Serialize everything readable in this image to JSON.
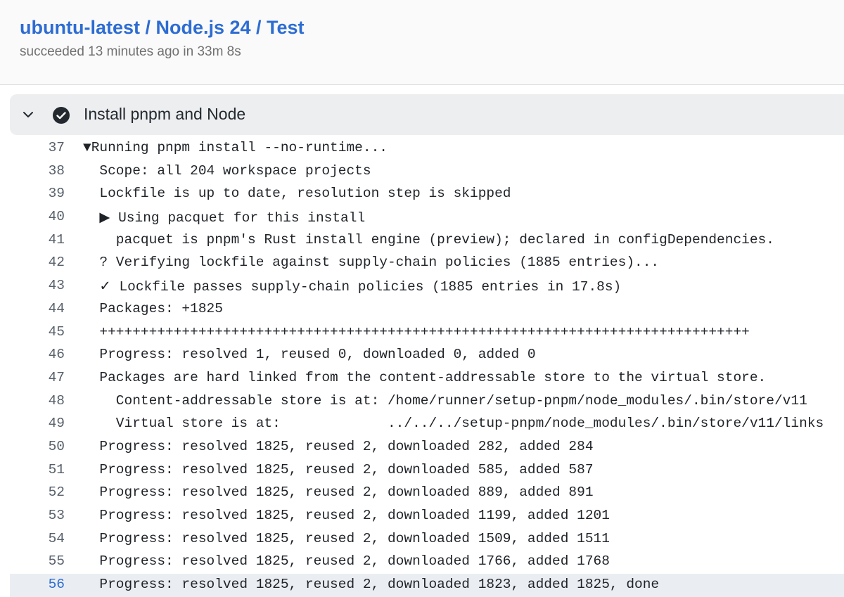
{
  "job": {
    "title": "ubuntu-latest / Node.js 24 / Test",
    "status": "succeeded 13 minutes ago in 33m 8s"
  },
  "step": {
    "title": "Install pnpm and Node",
    "icons": [
      "chevron-down-icon",
      "check-circle-icon"
    ]
  },
  "colors": {
    "link": "#2d6cd2",
    "header_bg": "#eceef0",
    "highlight_bg": "#eaeef2",
    "success_icon": "#24292f"
  },
  "log_lines": [
    {
      "num": "37",
      "text": "▼Running pnpm install --no-runtime..."
    },
    {
      "num": "38",
      "text": "  Scope: all 204 workspace projects"
    },
    {
      "num": "39",
      "text": "  Lockfile is up to date, resolution step is skipped"
    },
    {
      "num": "40",
      "text": "  ▶ Using pacquet for this install"
    },
    {
      "num": "41",
      "text": "    pacquet is pnpm's Rust install engine (preview); declared in configDependencies."
    },
    {
      "num": "42",
      "text": "  ? Verifying lockfile against supply-chain policies (1885 entries)..."
    },
    {
      "num": "43",
      "text": "  ✓ Lockfile passes supply-chain policies (1885 entries in 17.8s)"
    },
    {
      "num": "44",
      "text": "  Packages: +1825"
    },
    {
      "num": "45",
      "text": "  +++++++++++++++++++++++++++++++++++++++++++++++++++++++++++++++++++++++++++++++"
    },
    {
      "num": "46",
      "text": "  Progress: resolved 1, reused 0, downloaded 0, added 0"
    },
    {
      "num": "47",
      "text": "  Packages are hard linked from the content-addressable store to the virtual store."
    },
    {
      "num": "48",
      "text": "    Content-addressable store is at: /home/runner/setup-pnpm/node_modules/.bin/store/v11"
    },
    {
      "num": "49",
      "text": "    Virtual store is at:             ../../../setup-pnpm/node_modules/.bin/store/v11/links"
    },
    {
      "num": "50",
      "text": "  Progress: resolved 1825, reused 2, downloaded 282, added 284"
    },
    {
      "num": "51",
      "text": "  Progress: resolved 1825, reused 2, downloaded 585, added 587"
    },
    {
      "num": "52",
      "text": "  Progress: resolved 1825, reused 2, downloaded 889, added 891"
    },
    {
      "num": "53",
      "text": "  Progress: resolved 1825, reused 2, downloaded 1199, added 1201"
    },
    {
      "num": "54",
      "text": "  Progress: resolved 1825, reused 2, downloaded 1509, added 1511"
    },
    {
      "num": "55",
      "text": "  Progress: resolved 1825, reused 2, downloaded 1766, added 1768"
    },
    {
      "num": "56",
      "text": "  Progress: resolved 1825, reused 2, downloaded 1823, added 1825, done",
      "highlighted": true
    }
  ]
}
